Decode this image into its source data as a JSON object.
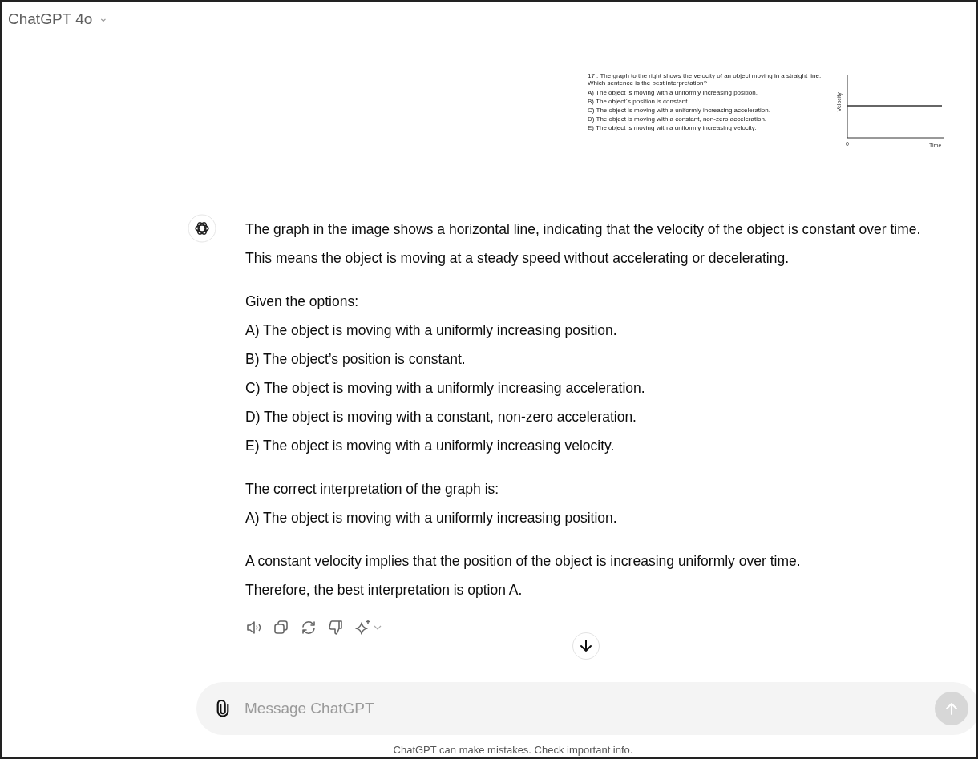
{
  "header": {
    "model": "ChatGPT 4o",
    "caret": "⌄"
  },
  "user_image": {
    "question": "17 . The graph to the right shows the velocity of an object moving in a straight line. Which sentence is the best interpretation?",
    "options": [
      "A) The object is moving with a uniformly increasing position.",
      "B) The object´s position is constant.",
      "C) The object is moving with a uniformly increasing acceleration.",
      "D) The object is moving with a constant, non-zero acceleration.",
      "E) The object is moving with a uniformly increasing velocity."
    ],
    "graph": {
      "ylabel": "Velocity",
      "origin": "0",
      "xlabel": "Time"
    }
  },
  "response": {
    "groups": [
      [
        "The graph in the image shows a horizontal line, indicating that the velocity of the object is constant over time. This means the object is moving at a steady speed without accelerating or decelerating."
      ],
      [
        "Given the options:",
        "A) The object is moving with a uniformly increasing position.",
        "B) The object’s position is constant.",
        "C) The object is moving with a uniformly increasing acceleration.",
        "D) The object is moving with a constant, non-zero acceleration.",
        "E) The object is moving with a uniformly increasing velocity."
      ],
      [
        "The correct interpretation of the graph is:",
        "A) The object is moving with a uniformly increasing position."
      ],
      [
        "A constant velocity implies that the position of the object is increasing uniformly over time.",
        "Therefore, the best interpretation is option A."
      ]
    ]
  },
  "actions": [
    {
      "kind": "speaker"
    },
    {
      "kind": "copy"
    },
    {
      "kind": "regenerate"
    },
    {
      "kind": "dislike"
    },
    {
      "kind": "sparkle"
    }
  ],
  "composer": {
    "placeholder": "Message ChatGPT"
  },
  "footer": "ChatGPT can make mistakes. Check important info."
}
